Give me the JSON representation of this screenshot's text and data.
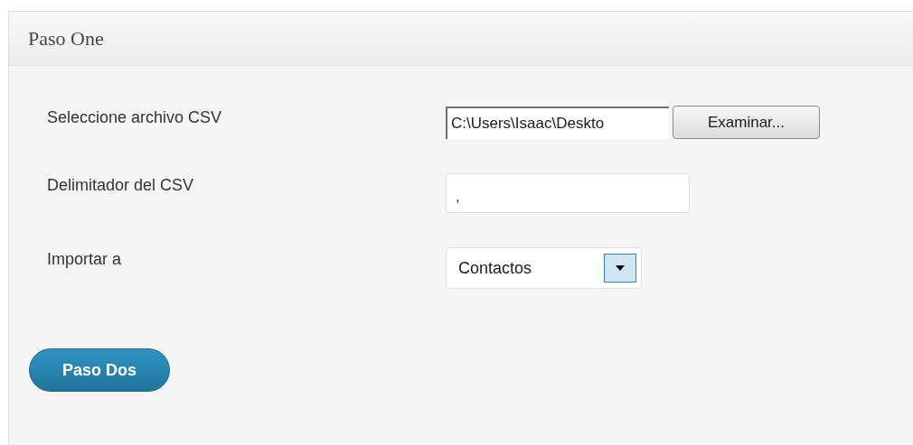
{
  "panel": {
    "title": "Paso One"
  },
  "rows": [
    {
      "kind": "file",
      "label": "Seleccione archivo CSV",
      "value": "C:\\Users\\Isaac\\Deskto",
      "button": "Examinar..."
    },
    {
      "kind": "text",
      "label": "Delimitador del CSV",
      "value": ","
    },
    {
      "kind": "select",
      "label": "Importar a",
      "value": "Contactos"
    }
  ],
  "submit": "Paso Dos"
}
